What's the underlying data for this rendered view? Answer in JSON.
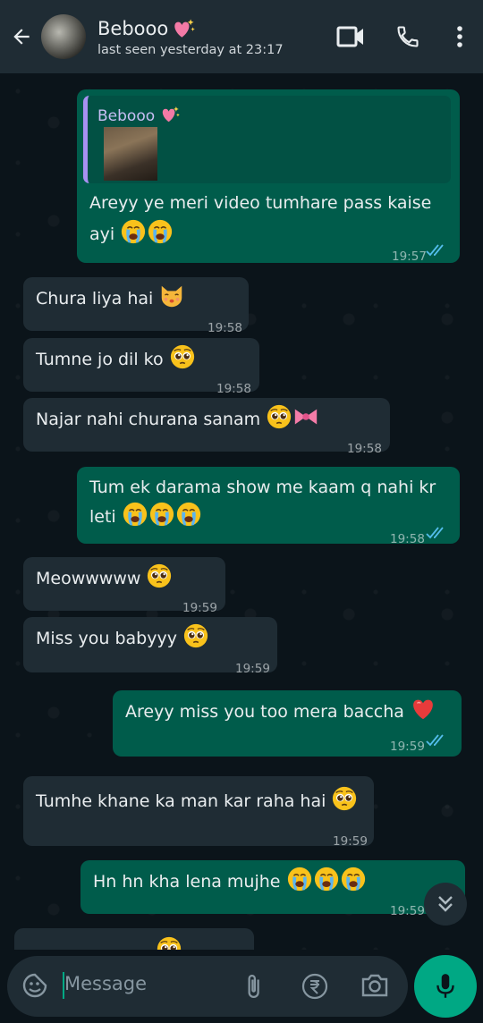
{
  "header": {
    "contact_name": "Bebooo",
    "last_seen": "last seen yesterday at 23:17"
  },
  "messages": [
    {
      "direction": "out",
      "reply_to": "Bebooo",
      "text1": "Areyy ye meri video tumhare pass kaise",
      "text2": "ayi",
      "time": "19:57",
      "status": "read"
    },
    {
      "direction": "in",
      "text": "Chura liya hai",
      "time": "19:58"
    },
    {
      "direction": "in",
      "text": "Tumne jo dil ko",
      "time": "19:58"
    },
    {
      "direction": "in",
      "text": "Najar nahi churana sanam",
      "time": "19:58"
    },
    {
      "direction": "out",
      "text1": "Tum ek darama show me kaam q nahi kr",
      "text2": "leti",
      "time": "19:58",
      "status": "read"
    },
    {
      "direction": "in",
      "text": "Meowwwww",
      "time": "19:59"
    },
    {
      "direction": "in",
      "text": "Miss you babyyy",
      "time": "19:59"
    },
    {
      "direction": "out",
      "text": "Areyy miss you too mera baccha",
      "time": "19:59",
      "status": "read"
    },
    {
      "direction": "in",
      "text": "Tumhe khane ka man kar raha hai",
      "time": "19:59"
    },
    {
      "direction": "out",
      "text": "Hn hn kha lena mujhe",
      "time": "19:59",
      "status": "sent"
    }
  ],
  "composer": {
    "placeholder": "Message"
  },
  "colors": {
    "header_bg": "#1f2c34",
    "chat_bg": "#0b141a",
    "outgoing_bubble": "#005c4b",
    "incoming_bubble": "#1f2c34",
    "accent": "#00a884",
    "read_ticks": "#53bdeb"
  },
  "icons": [
    "back-arrow-icon",
    "video-call-icon",
    "phone-icon",
    "more-vert-icon",
    "sticker-icon",
    "attach-icon",
    "rupee-icon",
    "camera-icon",
    "mic-icon",
    "double-chevron-down-icon"
  ]
}
